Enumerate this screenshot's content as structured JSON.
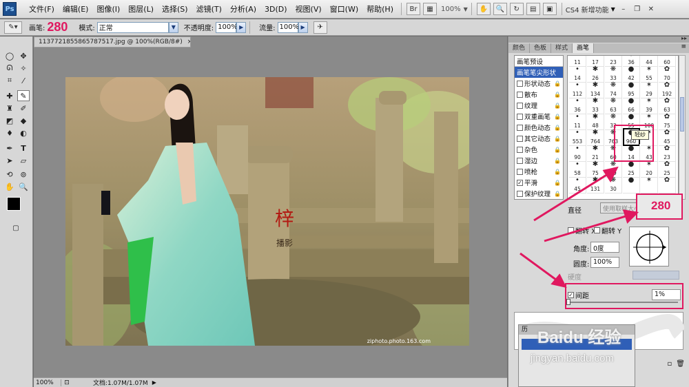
{
  "menubar": {
    "logo": "Ps",
    "items": [
      "文件(F)",
      "编辑(E)",
      "图像(I)",
      "图层(L)",
      "选择(S)",
      "滤镜(T)",
      "分析(A)",
      "3D(D)",
      "视图(V)",
      "窗口(W)",
      "帮助(H)"
    ],
    "zoom": "100%",
    "workspace": "CS4 新增功能"
  },
  "options": {
    "brush_label": "画笔:",
    "brush_size": "280",
    "mode_label": "模式:",
    "mode_value": "正常",
    "opacity_label": "不透明度:",
    "opacity_value": "100%",
    "flow_label": "流量:",
    "flow_value": "100%"
  },
  "document": {
    "tab_title": "1137721855865787517.jpg @ 100%(RGB/8#)",
    "zoom": "100%",
    "doc_info": "文档:1.07M/1.07M",
    "watermark_site": "ziphoto.photo.163.com"
  },
  "panel": {
    "tabs": [
      "颜色",
      "色板",
      "样式",
      "画笔"
    ],
    "active_tab": "画笔",
    "preset_header": "画笔预设",
    "sections": [
      {
        "label": "画笔笔尖形状",
        "checkbox": false,
        "selected": true,
        "checked": false,
        "lock": false
      },
      {
        "label": "形状动态",
        "checkbox": true,
        "selected": false,
        "checked": false,
        "lock": true
      },
      {
        "label": "散布",
        "checkbox": true,
        "selected": false,
        "checked": false,
        "lock": true
      },
      {
        "label": "纹理",
        "checkbox": true,
        "selected": false,
        "checked": false,
        "lock": true
      },
      {
        "label": "双重画笔",
        "checkbox": true,
        "selected": false,
        "checked": false,
        "lock": true
      },
      {
        "label": "颜色动态",
        "checkbox": true,
        "selected": false,
        "checked": false,
        "lock": true
      },
      {
        "label": "其它动态",
        "checkbox": true,
        "selected": false,
        "checked": false,
        "lock": true
      },
      {
        "label": "杂色",
        "checkbox": true,
        "selected": false,
        "checked": false,
        "lock": true
      },
      {
        "label": "湿边",
        "checkbox": true,
        "selected": false,
        "checked": false,
        "lock": true
      },
      {
        "label": "喷枪",
        "checkbox": true,
        "selected": false,
        "checked": false,
        "lock": true
      },
      {
        "label": "平滑",
        "checkbox": true,
        "selected": false,
        "checked": true,
        "lock": true
      },
      {
        "label": "保护纹理",
        "checkbox": true,
        "selected": false,
        "checked": false,
        "lock": true
      }
    ],
    "tip_rows": [
      [
        "11",
        "17",
        "23",
        "36",
        "44",
        "60"
      ],
      [
        "14",
        "26",
        "33",
        "42",
        "55",
        "70"
      ],
      [
        "112",
        "134",
        "74",
        "95",
        "29",
        "192"
      ],
      [
        "36",
        "33",
        "63",
        "66",
        "39",
        "63"
      ],
      [
        "11",
        "48",
        "32",
        "55",
        "100",
        "75"
      ],
      [
        "553",
        "764",
        "763",
        "960",
        "",
        "45"
      ],
      [
        "90",
        "21",
        "60",
        "14",
        "43",
        "23"
      ],
      [
        "58",
        "75",
        "59",
        "25",
        "20",
        "25"
      ],
      [
        "45",
        "131",
        "30",
        "",
        "",
        ""
      ]
    ],
    "selected_tip_label": "960",
    "tooltip": "轻纱",
    "diameter_label": "直径",
    "use_sample_size": "使用取样大小",
    "diameter_value": "280",
    "flip_x": "翻转 X",
    "flip_y": "翻转 Y",
    "angle_label": "角度:",
    "angle_value": "0度",
    "roundness_label": "圆度:",
    "roundness_value": "100%",
    "hardness_label": "硬度",
    "spacing_label": "间距",
    "spacing_value": "1%",
    "spacing_checked": true
  },
  "history": {
    "title": "历"
  },
  "watermark": {
    "brand": "Baidu 经验",
    "url": "jingyan.baidu.com",
    "photo_sig_1": "梓",
    "photo_sig_2": "播影"
  },
  "colors": {
    "accent": "#e0185f",
    "selection_blue": "#2f5fb7"
  }
}
